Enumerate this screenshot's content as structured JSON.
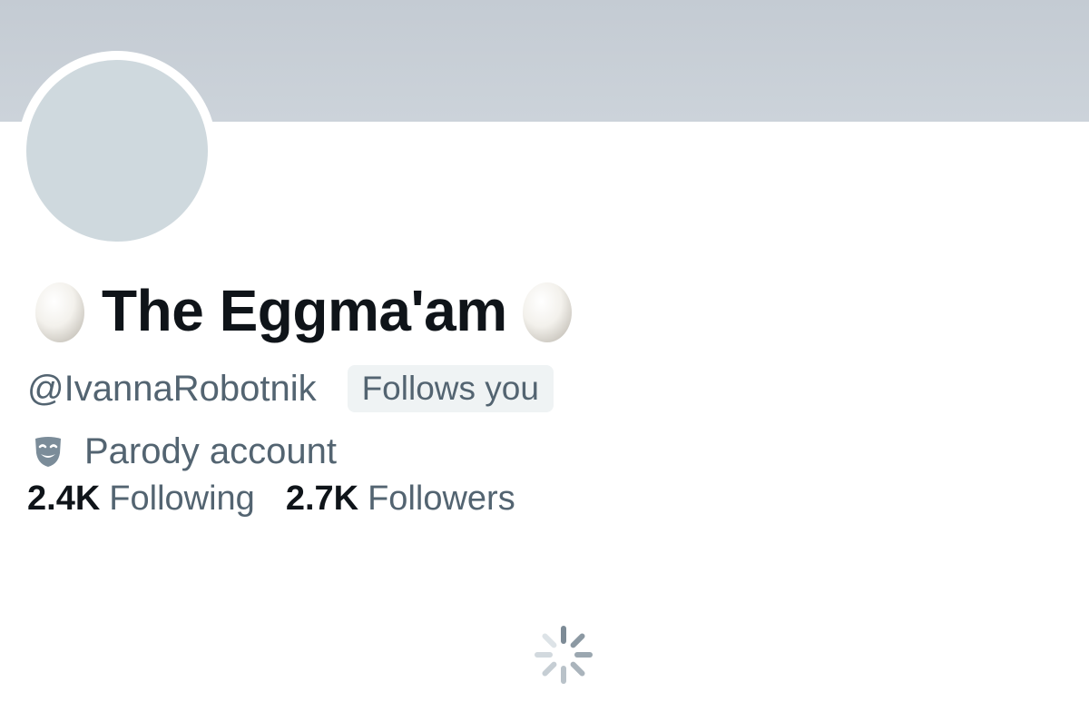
{
  "profile": {
    "display_name": "The Eggma'am",
    "name_prefix_emoji": "egg",
    "name_suffix_emoji": "egg",
    "handle": "@IvannaRobotnik",
    "follows_you_label": "Follows you",
    "parody_label": "Parody account",
    "parody_icon": "theater-mask-icon"
  },
  "stats": {
    "following_count": "2.4K",
    "following_label": "Following",
    "followers_count": "2.7K",
    "followers_label": "Followers"
  },
  "colors": {
    "banner": "#c8cfd6",
    "avatar_placeholder": "#cfd9de",
    "primary_text": "#0f1419",
    "secondary_text": "#536471",
    "badge_bg": "#eff3f4"
  },
  "loading": {
    "icon": "loading-spinner-icon"
  }
}
